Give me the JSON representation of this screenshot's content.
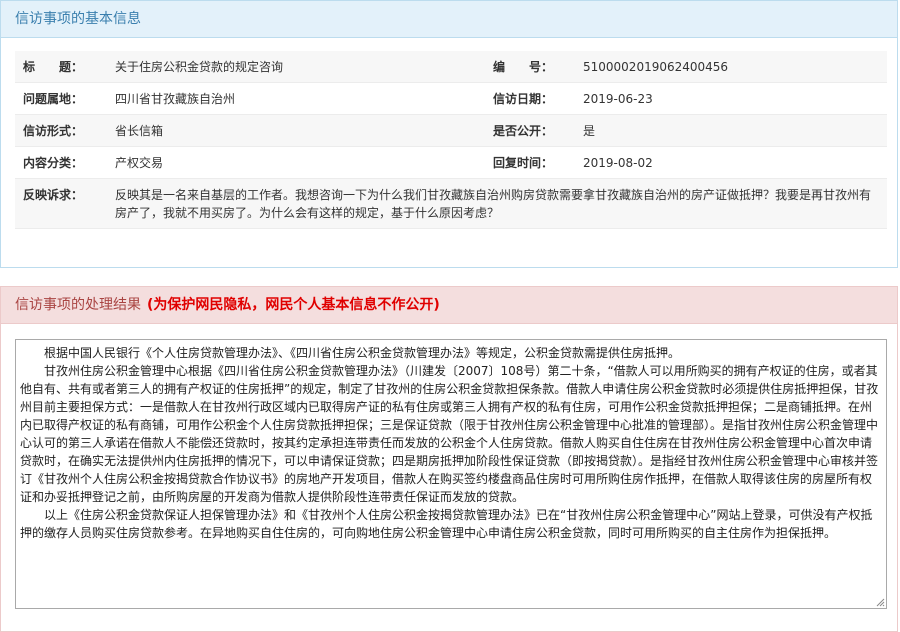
{
  "section1": {
    "title": "信访事项的基本信息",
    "rows": [
      {
        "l1": "标　　题：",
        "v1": "关于住房公积金贷款的规定咨询",
        "l2": "编　　号：",
        "v2": "5100002019062400456"
      },
      {
        "l1": "问题属地：",
        "v1": "四川省甘孜藏族自治州",
        "l2": "信访日期：",
        "v2": "2019-06-23"
      },
      {
        "l1": "信访形式：",
        "v1": "省长信箱",
        "l2": "是否公开：",
        "v2": "是"
      },
      {
        "l1": "内容分类：",
        "v1": "产权交易",
        "l2": "回复时间：",
        "v2": "2019-08-02"
      }
    ],
    "complaint_label": "反映诉求：",
    "complaint_text": "反映其是一名来自基层的工作者。我想咨询一下为什么我们甘孜藏族自治州购房贷款需要拿甘孜藏族自治州的房产证做抵押？我要是再甘孜州有房产了，我就不用买房了。为什么会有这样的规定，基于什么原因考虑？"
  },
  "section2": {
    "title": "信访事项的处理结果",
    "note": "(为保护网民隐私，网民个人基本信息不作公开)",
    "paragraphs": [
      "根据中国人民银行《个人住房贷款管理办法》、《四川省住房公积金贷款管理办法》等规定，公积金贷款需提供住房抵押。",
      "甘孜州住房公积金管理中心根据《四川省住房公积金贷款管理办法》（川建发〔2007〕108号）第二十条，“借款人可以用所购买的拥有产权证的住房，或者其他自有、共有或者第三人的拥有产权证的住房抵押”的规定，制定了甘孜州的住房公积金贷款担保条款。借款人申请住房公积金贷款时必须提供住房抵押担保，甘孜州目前主要担保方式：一是借款人在甘孜州行政区域内已取得房产证的私有住房或第三人拥有产权的私有住房，可用作公积金贷款抵押担保；二是商铺抵押。在州内已取得产权证的私有商铺，可用作公积金个人住房贷款抵押担保；三是保证贷款（限于甘孜州住房公积金管理中心批准的管理部）。是指甘孜州住房公积金管理中心认可的第三人承诺在借款人不能偿还贷款时，按其约定承担连带责任而发放的公积金个人住房贷款。借款人购买自住住房在甘孜州住房公积金管理中心首次申请贷款时，在确实无法提供州内住房抵押的情况下，可以申请保证贷款；四是期房抵押加阶段性保证贷款（即按揭贷款）。是指经甘孜州住房公积金管理中心审核并签订《甘孜州个人住房公积金按揭贷款合作协议书》的房地产开发项目，借款人在购买签约楼盘商品住房时可用所购住房作抵押，在借款人取得该住房的房屋所有权证和办妥抵押登记之前，由所购房屋的开发商为借款人提供阶段性连带责任保证而发放的贷款。",
      "以上《住房公积金贷款保证人担保管理办法》和《甘孜州个人住房公积金按揭贷款管理办法》已在“甘孜州住房公积金管理中心”网站上登录，可供没有产权抵押的缴存人员购买住房贷款参考。在异地购买自住住房的，可向购地住房公积金管理中心申请住房公积金贷款，同时可用所购买的自主住房作为担保抵押。"
    ]
  }
}
